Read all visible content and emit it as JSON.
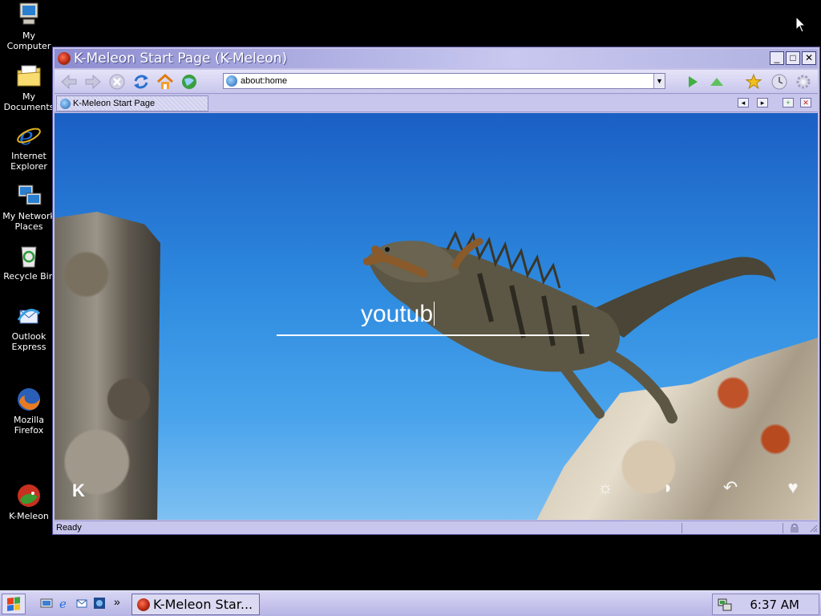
{
  "desktop": {
    "icons": [
      {
        "label": "My Computer"
      },
      {
        "label": "My Documents"
      },
      {
        "label": "Internet Explorer"
      },
      {
        "label": "My Network Places"
      },
      {
        "label": "Recycle Bin"
      },
      {
        "label": "Outlook Express"
      },
      {
        "label": "Mozilla Firefox"
      },
      {
        "label": "K-Meleon"
      }
    ]
  },
  "window": {
    "title": "K-Meleon Start Page (K-Meleon)",
    "controls": {
      "minimize": "_",
      "maximize": "□",
      "close": "✕"
    }
  },
  "toolbar": {
    "url": "about:home",
    "buttons": [
      "back-arrow-icon",
      "forward-arrow-icon",
      "stop-icon",
      "reload-icon",
      "home-icon",
      "globe-icon"
    ]
  },
  "tabs": [
    {
      "label": "K-Meleon Start Page",
      "active": true
    }
  ],
  "page": {
    "search_text": "youtub",
    "logo_letter": "K"
  },
  "status": {
    "text": "Ready"
  },
  "taskbar": {
    "task_label": "K-Meleon Star...",
    "overflow": "»",
    "clock": "6:37 AM"
  }
}
